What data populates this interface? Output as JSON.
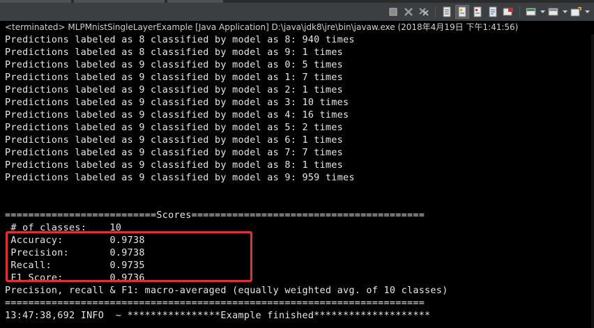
{
  "title": "<terminated> MLPMnistSingleLayerExample [Java Application] D:\\java\\jdk8\\jre\\bin\\javaw.exe (2018年4月19日 下午1:41:56)",
  "toolbar": {
    "buttons": [
      {
        "icon": "terminate-icon"
      },
      {
        "icon": "remove-launch-icon"
      },
      {
        "icon": "remove-all-terminated-icon"
      },
      {
        "icon": "scroll-lock-icon"
      },
      {
        "icon": "show-console-on-output-icon"
      },
      {
        "icon": "show-console-on-error-icon"
      },
      {
        "icon": "word-wrap-icon"
      },
      {
        "icon": "pin-console-icon"
      },
      {
        "icon": "display-selected-console-icon"
      },
      {
        "icon": "open-console-icon"
      }
    ]
  },
  "console": {
    "lines": [
      "Predictions labeled as 8 classified by model as 8: 940 times",
      "Predictions labeled as 8 classified by model as 9: 1 times",
      "Predictions labeled as 9 classified by model as 0: 5 times",
      "Predictions labeled as 9 classified by model as 1: 7 times",
      "Predictions labeled as 9 classified by model as 2: 1 times",
      "Predictions labeled as 9 classified by model as 3: 10 times",
      "Predictions labeled as 9 classified by model as 4: 16 times",
      "Predictions labeled as 9 classified by model as 5: 2 times",
      "Predictions labeled as 9 classified by model as 6: 1 times",
      "Predictions labeled as 9 classified by model as 7: 7 times",
      "Predictions labeled as 9 classified by model as 8: 1 times",
      "Predictions labeled as 9 classified by model as 9: 959 times",
      "",
      "",
      "==========================Scores========================================",
      " # of classes:    10",
      " Accuracy:        0.9738",
      " Precision:       0.9738",
      " Recall:          0.9735",
      " F1 Score:        0.9736",
      "Precision, recall & F1: macro-averaged (equally weighted avg. of 10 classes)",
      "========================================================================",
      "13:47:38,692 INFO  ~ ****************Example finished********************"
    ]
  },
  "colors": {
    "background": "#000000",
    "text": "#e6e6e6",
    "highlight": "#e03030",
    "toolbar": "#3c3f41"
  }
}
